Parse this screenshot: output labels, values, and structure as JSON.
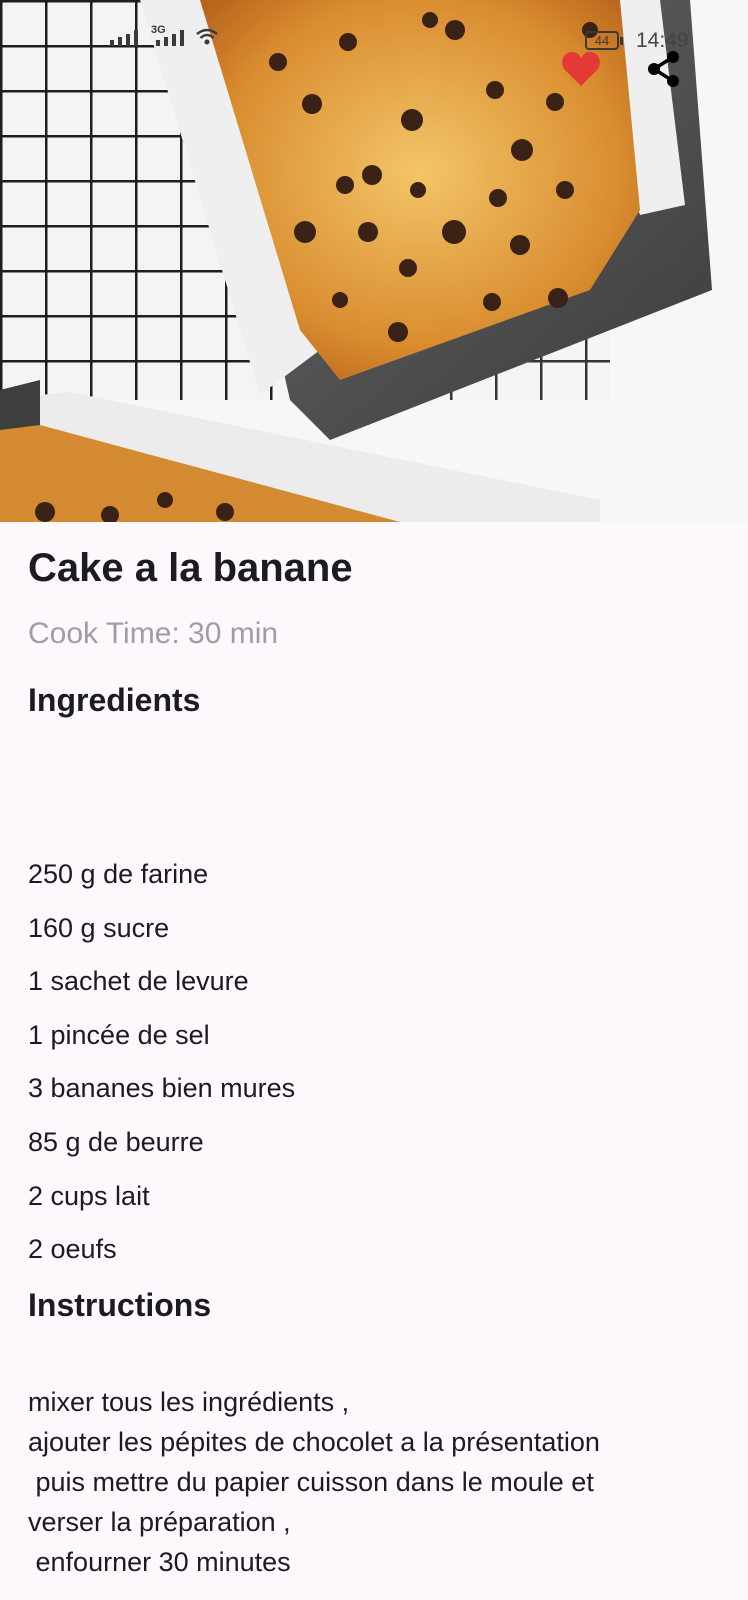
{
  "status_bar": {
    "network": "3G",
    "battery": "44",
    "time": "14:49"
  },
  "actions": {
    "favorite_icon": "heart-icon",
    "favorite_color": "#e53935",
    "share_icon": "share-icon"
  },
  "recipe": {
    "title": "Cake a la banane",
    "cook_time": "Cook Time: 30 min",
    "ingredients_heading": "Ingredients",
    "ingredients": [
      "250 g de farine",
      "160 g sucre",
      "1 sachet de levure",
      "1 pincée de sel",
      "3 bananes bien mures",
      "85 g de beurre",
      "2 cups lait",
      "2 oeufs"
    ],
    "instructions_heading": "Instructions",
    "instructions": "mixer tous les ingrédients ,\najouter les pépites de chocolet a la présentation\n puis mettre du papier cuisson dans le moule et\nverser la préparation ,\n enfourner 30 minutes"
  }
}
